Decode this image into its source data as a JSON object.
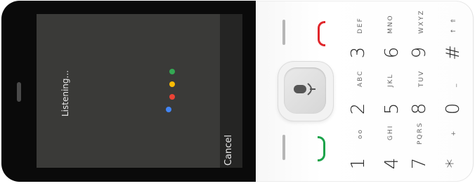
{
  "screen": {
    "status_text": "Listening...",
    "softkey_label": "Cancel"
  },
  "assistant_dots": {
    "colors": [
      "#34a853",
      "#fbbc05",
      "#ea4335",
      "#4285f4"
    ]
  },
  "keypad": {
    "keys": [
      {
        "digit": "1",
        "letters": "oo"
      },
      {
        "digit": "2",
        "letters": "ABC"
      },
      {
        "digit": "3",
        "letters": "DEF"
      },
      {
        "digit": "4",
        "letters": "GHI"
      },
      {
        "digit": "5",
        "letters": "JKL"
      },
      {
        "digit": "6",
        "letters": "MNO"
      },
      {
        "digit": "7",
        "letters": "PQRS"
      },
      {
        "digit": "8",
        "letters": "TUV"
      },
      {
        "digit": "9",
        "letters": "WXYZ"
      },
      {
        "digit": "*",
        "letters": "+"
      },
      {
        "digit": "0",
        "letters": "_"
      },
      {
        "digit": "#",
        "letters": "↑ ⇑"
      }
    ]
  },
  "icons": {
    "center_key": "microphone-icon",
    "call_key": "call-key-green",
    "end_key": "end-key-red"
  },
  "colors": {
    "call": "#1aa34a",
    "end": "#e0262b"
  }
}
